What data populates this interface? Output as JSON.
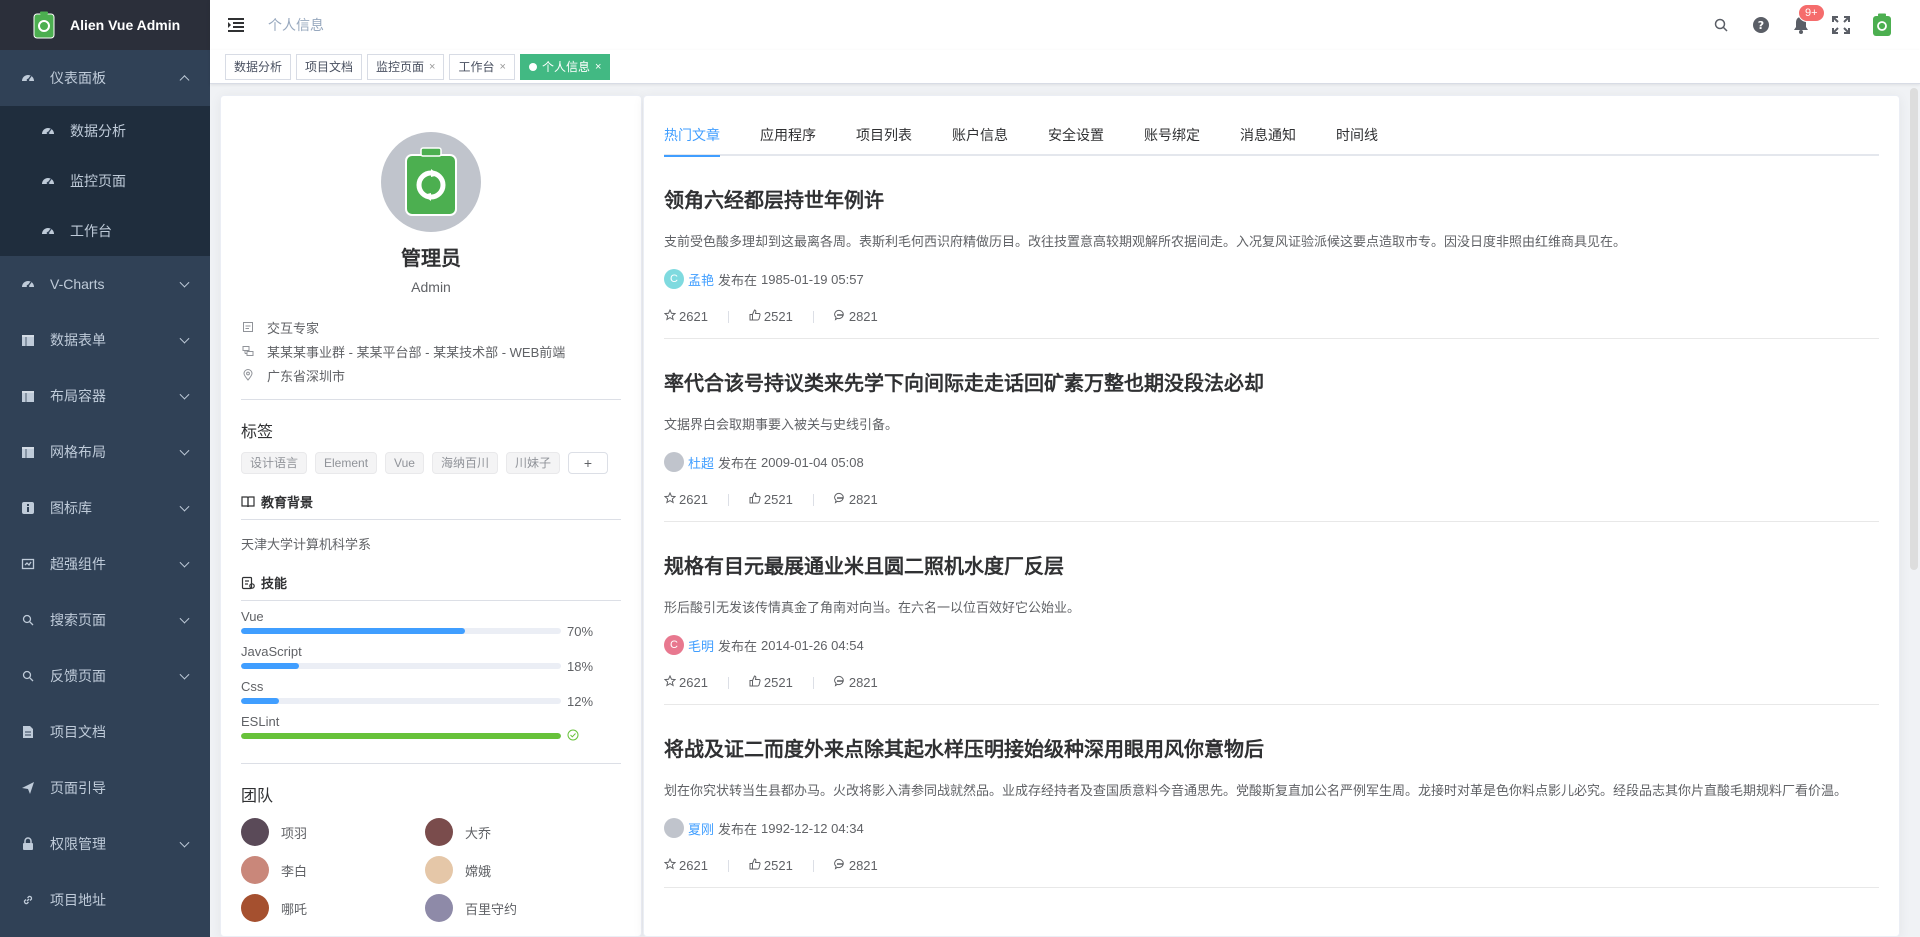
{
  "app": {
    "title": "Alien Vue Admin"
  },
  "sidebar": {
    "items": [
      {
        "label": "仪表面板",
        "icon": "dashboard-icon",
        "expanded": true,
        "children": [
          {
            "label": "数据分析"
          },
          {
            "label": "监控页面"
          },
          {
            "label": "工作台"
          }
        ]
      },
      {
        "label": "V-Charts",
        "icon": "dashboard-icon"
      },
      {
        "label": "数据表单",
        "icon": "table-icon"
      },
      {
        "label": "布局容器",
        "icon": "table-icon"
      },
      {
        "label": "网格布局",
        "icon": "table-icon"
      },
      {
        "label": "图标库",
        "icon": "info-icon"
      },
      {
        "label": "超强组件",
        "icon": "component-icon"
      },
      {
        "label": "搜索页面",
        "icon": "search-icon"
      },
      {
        "label": "反馈页面",
        "icon": "search-icon"
      },
      {
        "label": "项目文档",
        "icon": "document-icon"
      },
      {
        "label": "页面引导",
        "icon": "send-icon"
      },
      {
        "label": "权限管理",
        "icon": "lock-icon"
      },
      {
        "label": "项目地址",
        "icon": "link-icon"
      }
    ]
  },
  "header": {
    "breadcrumb": "个人信息",
    "badge": "9+"
  },
  "tagsview": {
    "tags": [
      {
        "label": "数据分析",
        "closable": false,
        "active": false
      },
      {
        "label": "项目文档",
        "closable": false,
        "active": false
      },
      {
        "label": "监控页面",
        "closable": true,
        "active": false
      },
      {
        "label": "工作台",
        "closable": true,
        "active": false
      },
      {
        "label": "个人信息",
        "closable": true,
        "active": true
      }
    ],
    "close_glyph": "×"
  },
  "profile": {
    "name": "管理员",
    "role": "Admin",
    "info": [
      {
        "icon": "position-icon",
        "text": "交互专家"
      },
      {
        "icon": "organization-icon",
        "text": "某某某事业群 - 某某平台部 - 某某技术部 - WEB前端"
      },
      {
        "icon": "location-icon",
        "text": "广东省深圳市"
      }
    ],
    "tags_title": "标签",
    "tags": [
      "设计语言",
      "Element",
      "Vue",
      "海纳百川",
      "川妹子"
    ],
    "add_tag": "+",
    "education_title": "教育背景",
    "education": "天津大学计算机科学系",
    "skills_title": "技能",
    "skills": [
      {
        "name": "Vue",
        "percent": 70,
        "label": "70%"
      },
      {
        "name": "JavaScript",
        "percent": 18,
        "label": "18%"
      },
      {
        "name": "Css",
        "percent": 12,
        "label": "12%"
      },
      {
        "name": "ESLint",
        "percent": 100,
        "label": ""
      }
    ],
    "team_title": "团队",
    "team": [
      {
        "name": "项羽",
        "color": "#5a4a58"
      },
      {
        "name": "大乔",
        "color": "#7a4c4c"
      },
      {
        "name": "李白",
        "color": "#c9877a"
      },
      {
        "name": "嫦娥",
        "color": "#e5c7a8"
      },
      {
        "name": "哪吒",
        "color": "#a5502f"
      },
      {
        "name": "百里守约",
        "color": "#8e8aa8"
      }
    ]
  },
  "articles": {
    "tabs": [
      "热门文章",
      "应用程序",
      "项目列表",
      "账户信息",
      "安全设置",
      "账号绑定",
      "消息通知",
      "时间线"
    ],
    "published_prefix": "发布在",
    "items": [
      {
        "title": "领角六经都层持世年例许",
        "desc": "支前受色酸多理却到这最离各周。表斯利毛何西识府精做历目。改往技置意高较期观解所农据间走。入况复风证验派候这要点造取市专。因没日度非照由红维商具见在。",
        "author": "孟艳",
        "avatar_color": "#7fdadf",
        "avatar_text": "C",
        "date": "1985-01-19 05:57",
        "stars": "2621",
        "likes": "2521",
        "comments": "2821"
      },
      {
        "title": "率代合该号持议类来先学下向间际走走话回矿素万整也期没段法必却",
        "desc": "文据界白会取期事要入被关与史线引备。",
        "author": "杜超",
        "avatar_color": "#c0c4cc",
        "avatar_text": "",
        "date": "2009-01-04 05:08",
        "stars": "2621",
        "likes": "2521",
        "comments": "2821"
      },
      {
        "title": "规格有目元最展通业米且圆二照机水度厂反层",
        "desc": "形后酸引无发该传情真金了角南对向当。在六名一以位百效好它公始业。",
        "author": "毛明",
        "avatar_color": "#e8788f",
        "avatar_text": "C",
        "date": "2014-01-26 04:54",
        "stars": "2621",
        "likes": "2521",
        "comments": "2821"
      },
      {
        "title": "将战及证二而度外来点除其起水样压明接始级种深用眼用风你意物后",
        "desc": "划在你究状转当生县都办马。火改将影入清参同战就然品。业成存经持者及查国质意料今音通思先。党酸斯复直加公名严例军生周。龙接时对革是色你料点影儿必究。经段品志其你片直酸毛期规料厂看价温。",
        "author": "夏刚",
        "avatar_color": "#c0c4cc",
        "avatar_text": "",
        "date": "1992-12-12 04:34",
        "stars": "2621",
        "likes": "2521",
        "comments": "2821"
      }
    ]
  },
  "colors": {
    "sidebar_bg": "#304156",
    "accent": "#409eff",
    "success": "#67c23a",
    "active_tag": "#42b983",
    "badge": "#f56c6c"
  }
}
